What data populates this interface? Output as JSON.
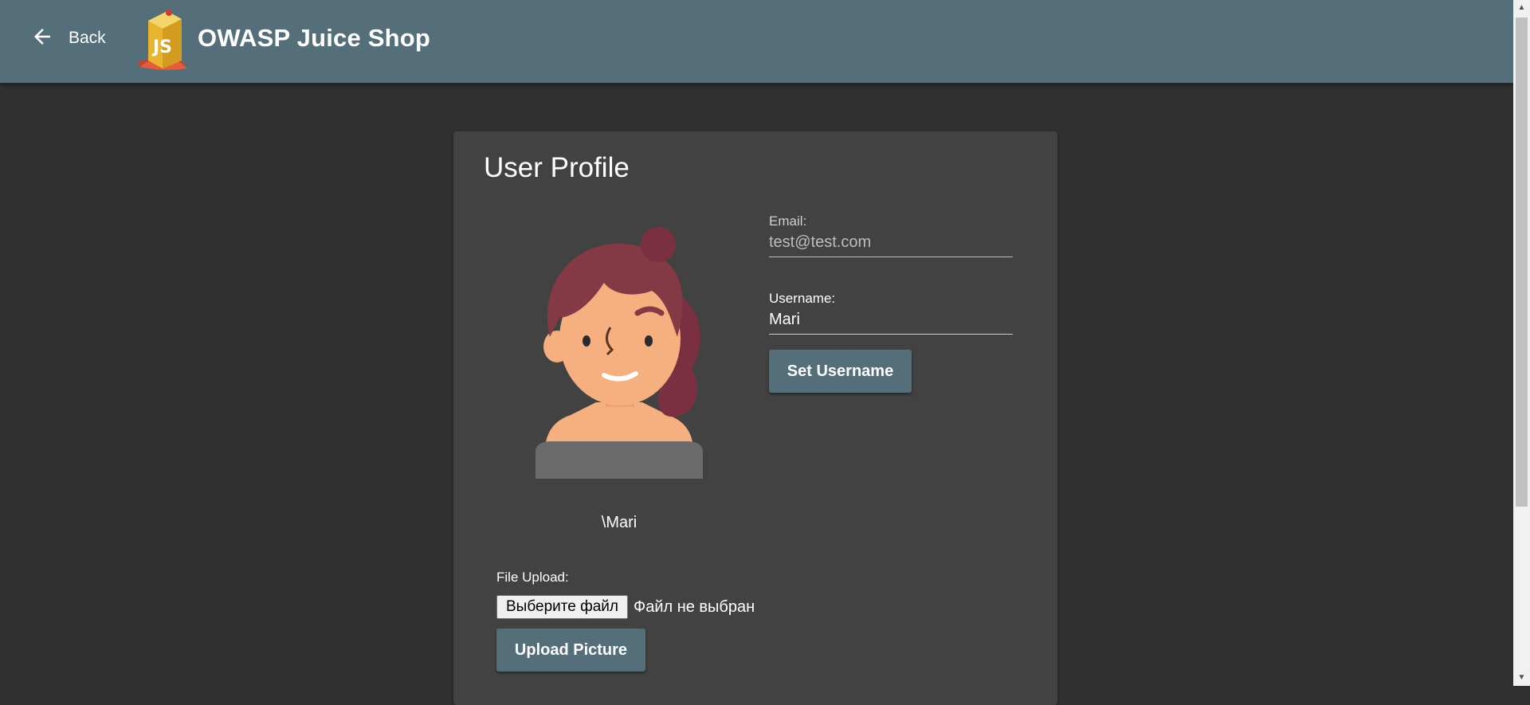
{
  "header": {
    "back_label": "Back",
    "title": "OWASP Juice Shop",
    "logo_text": "JS",
    "back_icon": "arrow-left-icon"
  },
  "profile": {
    "title": "User Profile",
    "avatar_caption": "\\Mari",
    "email": {
      "label": "Email:",
      "value": "test@test.com"
    },
    "username": {
      "label": "Username:",
      "value": "Mari"
    },
    "set_username_label": "Set Username",
    "file_upload_label": "File Upload:",
    "choose_file_label": "Выберите файл",
    "no_file_label": "Файл не выбран",
    "upload_picture_label": "Upload Picture"
  },
  "colors": {
    "toolbar": "#546e7a",
    "background": "#303030",
    "card": "#424242",
    "button": "#546e7a"
  }
}
